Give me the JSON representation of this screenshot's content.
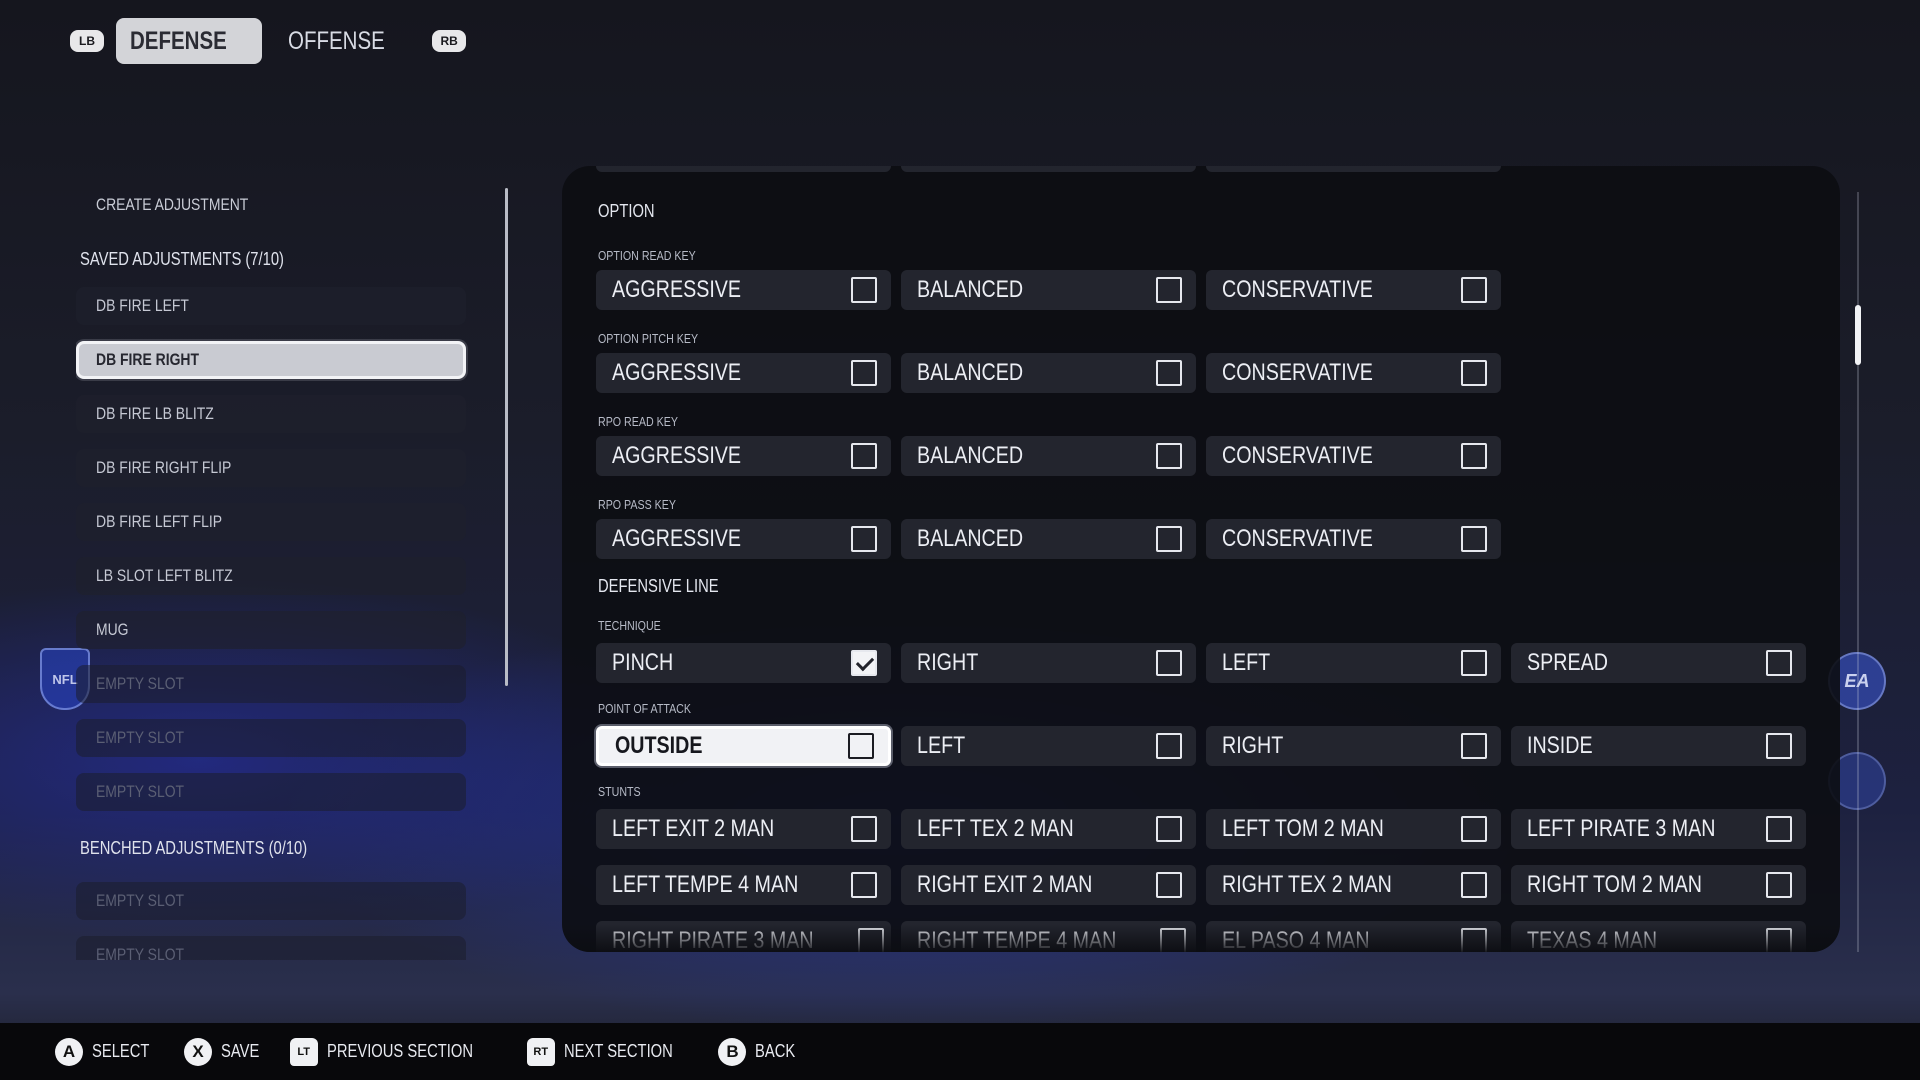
{
  "top_tabs": {
    "left_bumper": "LB",
    "right_bumper": "RB",
    "tabs": [
      {
        "label": "DEFENSE",
        "active": true
      },
      {
        "label": "OFFENSE",
        "active": false
      }
    ]
  },
  "sidebar": {
    "create_label": "CREATE ADJUSTMENT",
    "saved_header": "SAVED ADJUSTMENTS (7/10)",
    "saved_items": [
      {
        "label": "DB FIRE LEFT"
      },
      {
        "label": "DB FIRE RIGHT",
        "selected": true
      },
      {
        "label": "DB FIRE LB BLITZ"
      },
      {
        "label": "DB FIRE RIGHT FLIP"
      },
      {
        "label": "DB FIRE LEFT FLIP"
      },
      {
        "label": "LB SLOT LEFT BLITZ"
      },
      {
        "label": "MUG"
      },
      {
        "label": "EMPTY SLOT"
      },
      {
        "label": "EMPTY SLOT"
      },
      {
        "label": "EMPTY SLOT"
      }
    ],
    "benched_header": "BENCHED ADJUSTMENTS (0/10)",
    "benched_items": [
      {
        "label": "EMPTY SLOT"
      },
      {
        "label": "EMPTY SLOT"
      }
    ]
  },
  "panel": {
    "option": {
      "title": "OPTION",
      "groups": [
        {
          "label": "OPTION READ KEY",
          "options": [
            "AGGRESSIVE",
            "BALANCED",
            "CONSERVATIVE"
          ]
        },
        {
          "label": "OPTION PITCH KEY",
          "options": [
            "AGGRESSIVE",
            "BALANCED",
            "CONSERVATIVE"
          ]
        },
        {
          "label": "RPO READ KEY",
          "options": [
            "AGGRESSIVE",
            "BALANCED",
            "CONSERVATIVE"
          ]
        },
        {
          "label": "RPO PASS KEY",
          "options": [
            "AGGRESSIVE",
            "BALANCED",
            "CONSERVATIVE"
          ]
        }
      ]
    },
    "defensive_line": {
      "title": "DEFENSIVE LINE",
      "technique_label": "TECHNIQUE",
      "technique": [
        {
          "label": "PINCH",
          "checked": true
        },
        {
          "label": "RIGHT",
          "checked": false
        },
        {
          "label": "LEFT",
          "checked": false
        },
        {
          "label": "SPREAD",
          "checked": false
        }
      ],
      "poa_label": "POINT OF ATTACK",
      "poa": [
        {
          "label": "OUTSIDE",
          "checked": false,
          "focused": true
        },
        {
          "label": "LEFT",
          "checked": false
        },
        {
          "label": "RIGHT",
          "checked": false
        },
        {
          "label": "INSIDE",
          "checked": false
        }
      ],
      "stunts_label": "STUNTS",
      "stunts": [
        [
          "LEFT EXIT 2 MAN",
          "LEFT TEX 2 MAN",
          "LEFT TOM 2 MAN",
          "LEFT PIRATE 3 MAN"
        ],
        [
          "LEFT TEMPE 4 MAN",
          "RIGHT EXIT 2 MAN",
          "RIGHT TEX 2 MAN",
          "RIGHT TOM 2 MAN"
        ],
        [
          "RIGHT PIRATE 3 MAN",
          "RIGHT TEMPE 4 MAN",
          "EL PASO 4 MAN",
          "TEXAS 4 MAN"
        ]
      ]
    }
  },
  "logos": {
    "nfl": "NFL",
    "ea": "EA"
  },
  "footer": {
    "hints": [
      {
        "button": "A",
        "label": "SELECT"
      },
      {
        "button": "X",
        "label": "SAVE"
      },
      {
        "button": "LT",
        "label": "PREVIOUS SECTION"
      },
      {
        "button": "RT",
        "label": "NEXT SECTION"
      },
      {
        "button": "B",
        "label": "BACK"
      }
    ]
  }
}
